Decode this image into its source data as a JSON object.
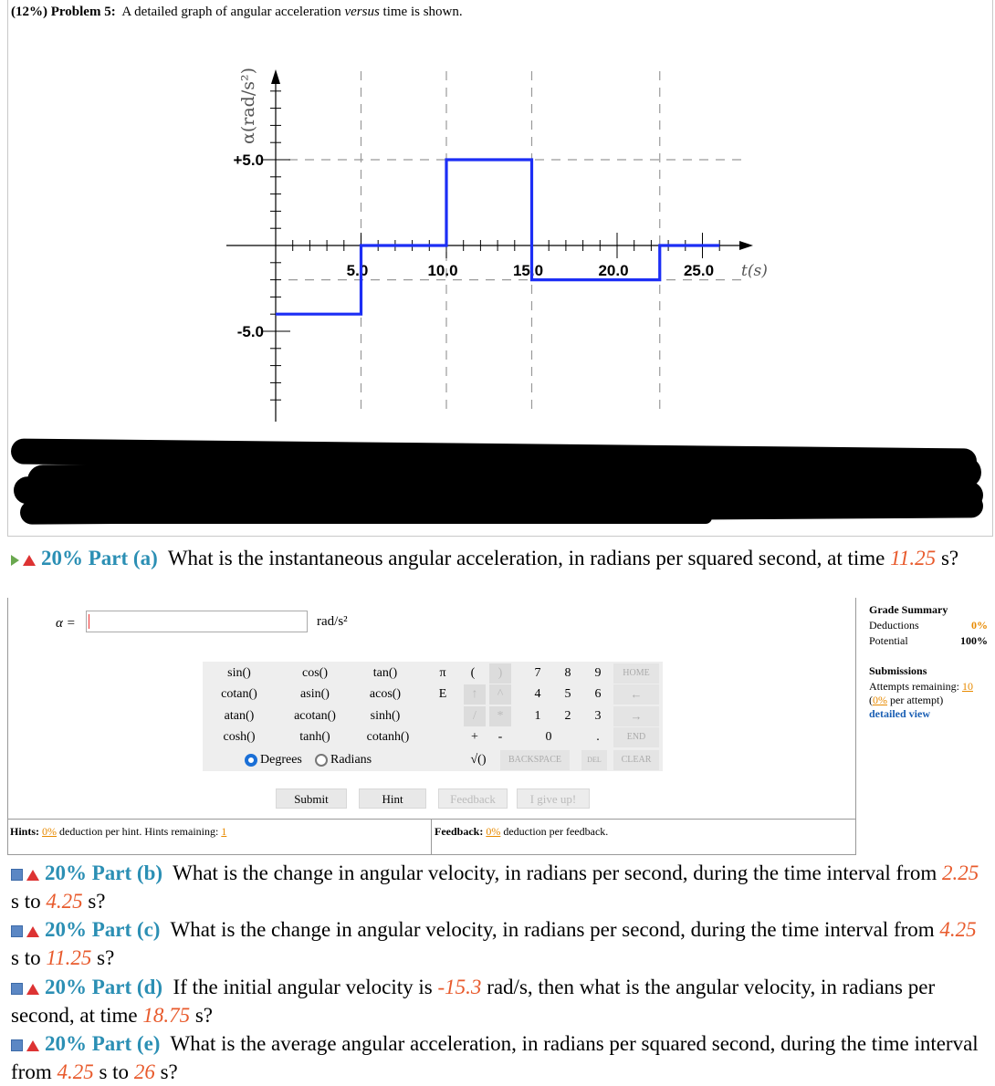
{
  "problem": {
    "weight": "(12%)",
    "number": "Problem 5:",
    "text_before": "A detailed graph of angular acceleration",
    "versus": "versus",
    "text_after": "time is shown."
  },
  "chart_data": {
    "type": "line",
    "ylabel": "α(rad/s²)",
    "xlabel": "t(s)",
    "xlim": [
      -1,
      26.5
    ],
    "ylim": [
      -9,
      10
    ],
    "x_ticks": [
      "5.0",
      "10.0",
      "15.0",
      "20.0",
      "25.0"
    ],
    "y_ticks": [
      "+5.0",
      "-5.0"
    ],
    "grid": "dashed",
    "series": [
      {
        "x": [
          0,
          5,
          5,
          10,
          10,
          15,
          15,
          22.5,
          22.5,
          26
        ],
        "y": [
          -4,
          -4,
          0,
          0,
          5,
          5,
          -2,
          -2,
          0,
          0
        ]
      }
    ],
    "line_color": "#1c2ef5"
  },
  "part_a": {
    "percent": "20%",
    "label": "Part (a)",
    "question": "What is the instantaneous angular acceleration, in radians per squared second, at time",
    "time_value": "11.25",
    "time_suffix": "s?",
    "input_label": "α =",
    "input_value": "",
    "units": "rad/s²"
  },
  "keypad": {
    "functions": [
      [
        "sin()",
        "cos()",
        "tan()"
      ],
      [
        "cotan()",
        "asin()",
        "acos()"
      ],
      [
        "atan()",
        "acotan()",
        "sinh()"
      ],
      [
        "cosh()",
        "tanh()",
        "cotanh()"
      ]
    ],
    "degrees": "Degrees",
    "radians": "Radians",
    "pi": "π",
    "e": "E",
    "lparen": "(",
    "rparen": ")",
    "up": "↑",
    "upcaret": "^",
    "down": "↓",
    "slash": "/",
    "star": "*",
    "plus": "+",
    "minus": "-",
    "sqrt": "√()",
    "digits": [
      "7",
      "8",
      "9",
      "4",
      "5",
      "6",
      "1",
      "2",
      "3",
      "0",
      "."
    ],
    "home": "HOME",
    "left": "←",
    "right": "→",
    "end": "END",
    "backspace": "BACKSPACE",
    "del": "DEL",
    "clear": "CLEAR"
  },
  "buttons": {
    "submit": "Submit",
    "hint": "Hint",
    "feedback": "Feedback",
    "give_up": "I give up!"
  },
  "hints": {
    "label": "Hints:",
    "pct": "0%",
    "text": "deduction per hint. Hints remaining:",
    "remaining": "1"
  },
  "feedback": {
    "label": "Feedback:",
    "pct": "0%",
    "text": "deduction per feedback."
  },
  "grade_summary": {
    "title": "Grade Summary",
    "deductions_label": "Deductions",
    "deductions_value": "0%",
    "potential_label": "Potential",
    "potential_value": "100%",
    "submissions_title": "Submissions",
    "attempts_label": "Attempts remaining:",
    "attempts_value": "10",
    "per_attempt_pct": "0%",
    "per_attempt_text": "per attempt)",
    "detailed_view": "detailed view"
  },
  "part_b": {
    "percent": "20%",
    "label": "Part (b)",
    "q1": "What is the change in angular velocity, in radians per second, during the time interval",
    "q2a": "from",
    "v1": "2.25",
    "q2b": "s to",
    "v2": "4.25",
    "q2c": "s?"
  },
  "part_c": {
    "percent": "20%",
    "label": "Part (c)",
    "q1": "What is the change in angular velocity, in radians per second, during the time interval",
    "q2a": "from",
    "v1": "4.25",
    "q2b": "s to",
    "v2": "11.25",
    "q2c": "s?"
  },
  "part_d": {
    "percent": "20%",
    "label": "Part (d)",
    "q1a": "If the initial angular velocity is",
    "v1": "-15.3",
    "q1b": "rad/s, then what is the angular velocity, in radians",
    "q2a": "per second, at time",
    "v2": "18.75",
    "q2b": "s?"
  },
  "part_e": {
    "percent": "20%",
    "label": "Part (e)",
    "q1": "What is the average angular acceleration, in radians per squared second, during the time",
    "q2a": "interval from",
    "v1": "4.25",
    "q2b": "s to",
    "v2": "26",
    "q2c": "s?"
  }
}
